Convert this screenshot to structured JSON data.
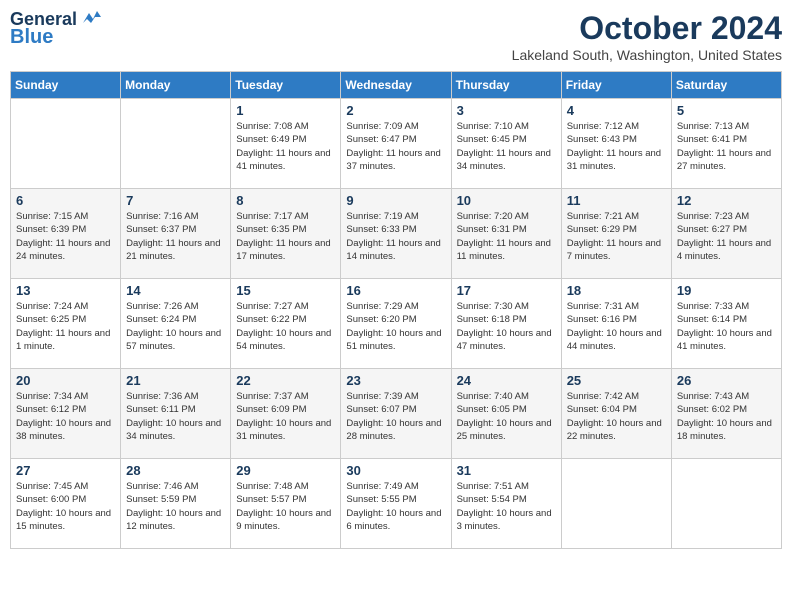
{
  "header": {
    "logo_line1": "General",
    "logo_line2": "Blue",
    "month_title": "October 2024",
    "location": "Lakeland South, Washington, United States"
  },
  "days_of_week": [
    "Sunday",
    "Monday",
    "Tuesday",
    "Wednesday",
    "Thursday",
    "Friday",
    "Saturday"
  ],
  "weeks": [
    [
      {
        "day": "",
        "info": ""
      },
      {
        "day": "",
        "info": ""
      },
      {
        "day": "1",
        "info": "Sunrise: 7:08 AM\nSunset: 6:49 PM\nDaylight: 11 hours and 41 minutes."
      },
      {
        "day": "2",
        "info": "Sunrise: 7:09 AM\nSunset: 6:47 PM\nDaylight: 11 hours and 37 minutes."
      },
      {
        "day": "3",
        "info": "Sunrise: 7:10 AM\nSunset: 6:45 PM\nDaylight: 11 hours and 34 minutes."
      },
      {
        "day": "4",
        "info": "Sunrise: 7:12 AM\nSunset: 6:43 PM\nDaylight: 11 hours and 31 minutes."
      },
      {
        "day": "5",
        "info": "Sunrise: 7:13 AM\nSunset: 6:41 PM\nDaylight: 11 hours and 27 minutes."
      }
    ],
    [
      {
        "day": "6",
        "info": "Sunrise: 7:15 AM\nSunset: 6:39 PM\nDaylight: 11 hours and 24 minutes."
      },
      {
        "day": "7",
        "info": "Sunrise: 7:16 AM\nSunset: 6:37 PM\nDaylight: 11 hours and 21 minutes."
      },
      {
        "day": "8",
        "info": "Sunrise: 7:17 AM\nSunset: 6:35 PM\nDaylight: 11 hours and 17 minutes."
      },
      {
        "day": "9",
        "info": "Sunrise: 7:19 AM\nSunset: 6:33 PM\nDaylight: 11 hours and 14 minutes."
      },
      {
        "day": "10",
        "info": "Sunrise: 7:20 AM\nSunset: 6:31 PM\nDaylight: 11 hours and 11 minutes."
      },
      {
        "day": "11",
        "info": "Sunrise: 7:21 AM\nSunset: 6:29 PM\nDaylight: 11 hours and 7 minutes."
      },
      {
        "day": "12",
        "info": "Sunrise: 7:23 AM\nSunset: 6:27 PM\nDaylight: 11 hours and 4 minutes."
      }
    ],
    [
      {
        "day": "13",
        "info": "Sunrise: 7:24 AM\nSunset: 6:25 PM\nDaylight: 11 hours and 1 minute."
      },
      {
        "day": "14",
        "info": "Sunrise: 7:26 AM\nSunset: 6:24 PM\nDaylight: 10 hours and 57 minutes."
      },
      {
        "day": "15",
        "info": "Sunrise: 7:27 AM\nSunset: 6:22 PM\nDaylight: 10 hours and 54 minutes."
      },
      {
        "day": "16",
        "info": "Sunrise: 7:29 AM\nSunset: 6:20 PM\nDaylight: 10 hours and 51 minutes."
      },
      {
        "day": "17",
        "info": "Sunrise: 7:30 AM\nSunset: 6:18 PM\nDaylight: 10 hours and 47 minutes."
      },
      {
        "day": "18",
        "info": "Sunrise: 7:31 AM\nSunset: 6:16 PM\nDaylight: 10 hours and 44 minutes."
      },
      {
        "day": "19",
        "info": "Sunrise: 7:33 AM\nSunset: 6:14 PM\nDaylight: 10 hours and 41 minutes."
      }
    ],
    [
      {
        "day": "20",
        "info": "Sunrise: 7:34 AM\nSunset: 6:12 PM\nDaylight: 10 hours and 38 minutes."
      },
      {
        "day": "21",
        "info": "Sunrise: 7:36 AM\nSunset: 6:11 PM\nDaylight: 10 hours and 34 minutes."
      },
      {
        "day": "22",
        "info": "Sunrise: 7:37 AM\nSunset: 6:09 PM\nDaylight: 10 hours and 31 minutes."
      },
      {
        "day": "23",
        "info": "Sunrise: 7:39 AM\nSunset: 6:07 PM\nDaylight: 10 hours and 28 minutes."
      },
      {
        "day": "24",
        "info": "Sunrise: 7:40 AM\nSunset: 6:05 PM\nDaylight: 10 hours and 25 minutes."
      },
      {
        "day": "25",
        "info": "Sunrise: 7:42 AM\nSunset: 6:04 PM\nDaylight: 10 hours and 22 minutes."
      },
      {
        "day": "26",
        "info": "Sunrise: 7:43 AM\nSunset: 6:02 PM\nDaylight: 10 hours and 18 minutes."
      }
    ],
    [
      {
        "day": "27",
        "info": "Sunrise: 7:45 AM\nSunset: 6:00 PM\nDaylight: 10 hours and 15 minutes."
      },
      {
        "day": "28",
        "info": "Sunrise: 7:46 AM\nSunset: 5:59 PM\nDaylight: 10 hours and 12 minutes."
      },
      {
        "day": "29",
        "info": "Sunrise: 7:48 AM\nSunset: 5:57 PM\nDaylight: 10 hours and 9 minutes."
      },
      {
        "day": "30",
        "info": "Sunrise: 7:49 AM\nSunset: 5:55 PM\nDaylight: 10 hours and 6 minutes."
      },
      {
        "day": "31",
        "info": "Sunrise: 7:51 AM\nSunset: 5:54 PM\nDaylight: 10 hours and 3 minutes."
      },
      {
        "day": "",
        "info": ""
      },
      {
        "day": "",
        "info": ""
      }
    ]
  ]
}
